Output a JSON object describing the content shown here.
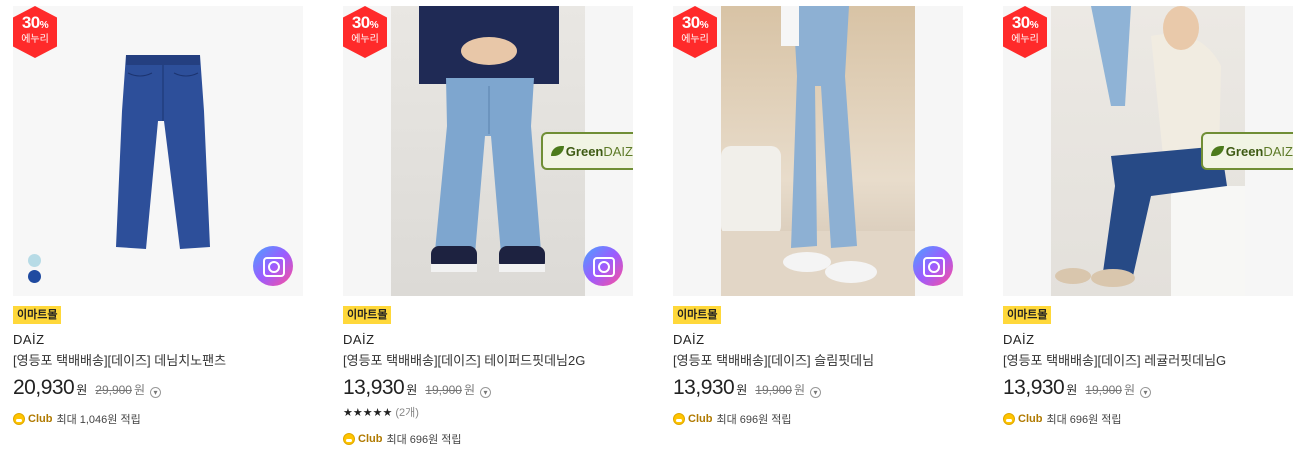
{
  "products": [
    {
      "badge": {
        "percent": "30",
        "percent_sign": "%",
        "label": "에누리"
      },
      "mall_tag": "이마트몰",
      "brand": "DAİZ",
      "name": "[영등포 택배배송][데이즈] 데님치노팬츠",
      "price": "20,930",
      "price_unit": "원",
      "original_price": "29,900",
      "original_unit": "원",
      "rating": null,
      "club": {
        "label": "Club",
        "text": "최대 1,046원 적립"
      },
      "swatches": [
        "#b7dbe6",
        "#1f4aa0"
      ],
      "has_green_label": false
    },
    {
      "badge": {
        "percent": "30",
        "percent_sign": "%",
        "label": "에누리"
      },
      "mall_tag": "이마트몰",
      "brand": "DAİZ",
      "name": "[영등포 택배배송][데이즈] 테이퍼드핏데님2G",
      "price": "13,930",
      "price_unit": "원",
      "original_price": "19,900",
      "original_unit": "원",
      "rating": {
        "stars": "★★★★★",
        "count": "(2개)"
      },
      "club": {
        "label": "Club",
        "text": "최대 696원 적립"
      },
      "swatches": [],
      "has_green_label": true
    },
    {
      "badge": {
        "percent": "30",
        "percent_sign": "%",
        "label": "에누리"
      },
      "mall_tag": "이마트몰",
      "brand": "DAİZ",
      "name": "[영등포 택배배송][데이즈] 슬림핏데님",
      "price": "13,930",
      "price_unit": "원",
      "original_price": "19,900",
      "original_unit": "원",
      "rating": null,
      "club": {
        "label": "Club",
        "text": "최대 696원 적립"
      },
      "swatches": [],
      "has_green_label": false
    },
    {
      "badge": {
        "percent": "30",
        "percent_sign": "%",
        "label": "에누리"
      },
      "mall_tag": "이마트몰",
      "brand": "DAİZ",
      "name": "[영등포 택배배송][데이즈] 레귤러핏데님G",
      "price": "13,930",
      "price_unit": "원",
      "original_price": "19,900",
      "original_unit": "원",
      "rating": null,
      "club": {
        "label": "Club",
        "text": "최대 696원 적립"
      },
      "swatches": [],
      "has_green_label": true
    }
  ],
  "green_label": {
    "green": "Green",
    "daiz": "DAIZ"
  },
  "icons": {
    "review_camera": "camera-icon",
    "price_info": "info-icon",
    "club_coin": "club-coin-icon",
    "green_leaf": "leaf-icon"
  },
  "colors": {
    "badge_red": "#ff2a2a",
    "tag_yellow": "#ffd83a",
    "club_gold": "#ffc400"
  }
}
